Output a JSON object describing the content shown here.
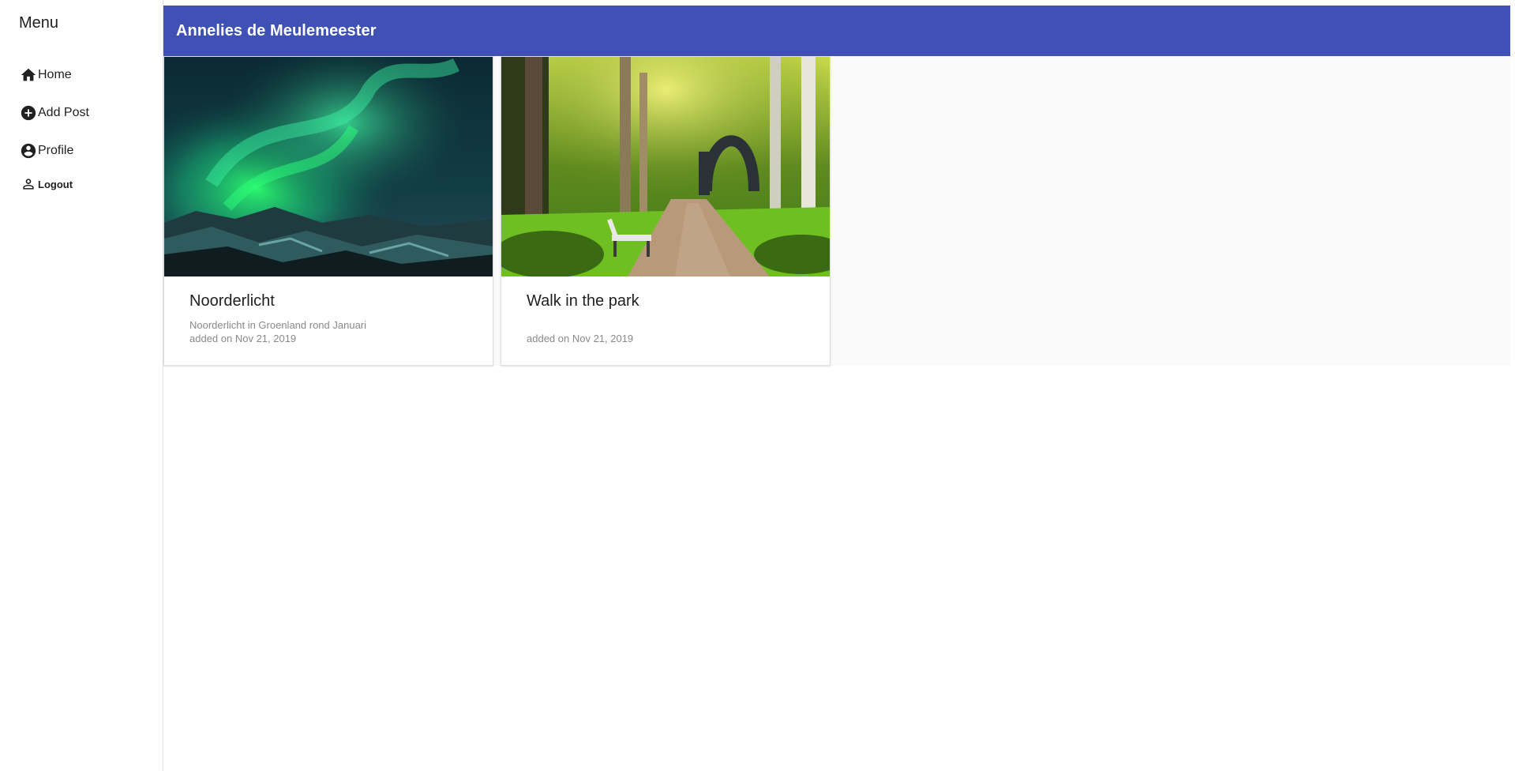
{
  "sidebar": {
    "title": "Menu",
    "items": [
      {
        "label": "Home",
        "icon": "home-icon"
      },
      {
        "label": "Add Post",
        "icon": "add-circle-icon"
      },
      {
        "label": "Profile",
        "icon": "account-circle-icon"
      },
      {
        "label": "Logout",
        "icon": "person-outline-icon"
      }
    ]
  },
  "header": {
    "title": "Annelies de Meulemeester",
    "color": "#3f51b5"
  },
  "posts": [
    {
      "title": "Noorderlicht",
      "description": "Noorderlicht in Groenland rond Januari",
      "date": "added on Nov 21, 2019",
      "image": "aurora-photo"
    },
    {
      "title": "Walk in the park",
      "description": "",
      "date": "added on Nov 21, 2019",
      "image": "park-path-photo"
    }
  ]
}
